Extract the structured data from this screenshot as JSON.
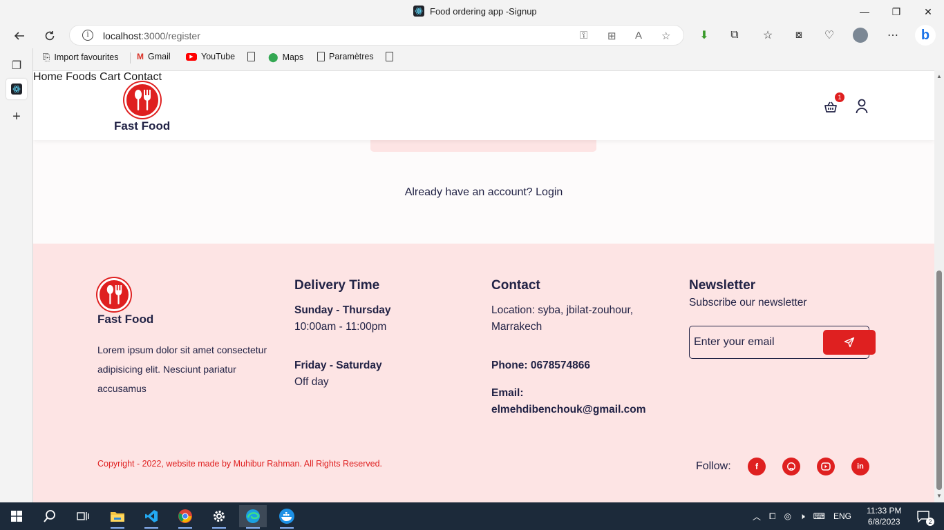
{
  "window": {
    "title": "Food ordering app -Signup",
    "controls": {
      "minimize": "—",
      "maximize": "❐",
      "close": "✕"
    }
  },
  "browser": {
    "url_host": "localhost",
    "url_path": ":3000/register",
    "favourites": [
      {
        "label": "Import favourites",
        "icon": "import-icon"
      },
      {
        "label": "Gmail",
        "icon": "gmail-icon"
      },
      {
        "label": "YouTube",
        "icon": "youtube-icon"
      },
      {
        "label": "",
        "icon": "document-icon"
      },
      {
        "label": "Maps",
        "icon": "maps-icon"
      },
      {
        "label": "Paramètres",
        "icon": "document-icon"
      },
      {
        "label": "",
        "icon": "document-icon"
      }
    ]
  },
  "site": {
    "brand": "Fast Food",
    "nav": [
      "Home",
      "Foods",
      "Cart",
      "Contact"
    ],
    "cart_count": "1",
    "login_prompt": "Already have an account? Login",
    "accent_color": "#df2020",
    "text_color": "#212245",
    "footer_bg": "#fde4e4"
  },
  "footer": {
    "brand": "Fast Food",
    "description": "Lorem ipsum dolor sit amet consectetur adipisicing elit. Nesciunt pariatur accusamus",
    "delivery": {
      "heading": "Delivery Time",
      "days1": "Sunday - Thursday",
      "hours1": "10:00am - 11:00pm",
      "days2": "Friday - Saturday",
      "hours2": "Off day"
    },
    "contact": {
      "heading": "Contact",
      "location": "Location: syba, jbilat-zouhour, Marrakech",
      "phone": "Phone: 0678574866",
      "email_label": "Email:",
      "email": "elmehdibenchouk@gmail.com"
    },
    "newsletter": {
      "heading": "Newsletter",
      "subtitle": "Subscribe our newsletter",
      "placeholder": "Enter your email"
    },
    "copyright": "Copyright - 2022, website made by Muhibur Rahman. All Rights Reserved.",
    "follow": "Follow:",
    "social": [
      "facebook-icon",
      "github-icon",
      "youtube-icon",
      "linkedin-icon"
    ]
  },
  "taskbar": {
    "language": "ENG",
    "time": "11:33 PM",
    "date": "6/8/2023",
    "notifications": "2"
  }
}
